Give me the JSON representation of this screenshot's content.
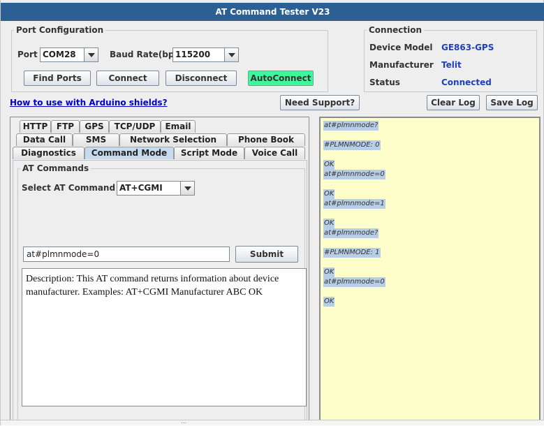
{
  "window": {
    "title": "AT Command Tester V23"
  },
  "port_config": {
    "legend": "Port Configuration",
    "port_label": "Port",
    "port_value": "COM28",
    "baud_label": "Baud Rate(bps)",
    "baud_value": "115200",
    "buttons": {
      "find_ports": "Find Ports",
      "connect": "Connect",
      "disconnect": "Disconnect",
      "autoconnect": "AutoConnect"
    }
  },
  "connection": {
    "legend": "Connection",
    "device_model_label": "Device Model",
    "device_model_value": "GE863-GPS",
    "manufacturer_label": "Manufacturer",
    "manufacturer_value": "Telit",
    "status_label": "Status",
    "status_value": "Connected"
  },
  "toolbar": {
    "arduino_link": "How to use with Arduino shields?",
    "need_support": "Need Support?",
    "clear_log": "Clear Log",
    "save_log": "Save Log"
  },
  "tabs": {
    "row1": [
      "HTTP",
      "FTP",
      "GPS",
      "TCP/UDP",
      "Email"
    ],
    "row2": [
      "Data Call",
      "SMS",
      "Network Selection",
      "Phone Book"
    ],
    "row3": [
      "Diagnostics",
      "Command Mode",
      "Script Mode",
      "Voice Call"
    ],
    "active": "Command Mode"
  },
  "at_commands": {
    "legend": "AT Commands",
    "select_label": "Select AT Command",
    "select_value": "AT+CGMI",
    "input_value": "at#plmnmode=0",
    "submit": "Submit",
    "description": "Description: This AT command returns information about device manufacturer. Examples: AT+CGMI Manufacturer ABC OK"
  },
  "log_lines": [
    "at#plmnmode?",
    "#PLMNMODE: 0",
    "OK",
    "at#plmnmode=0",
    "OK",
    "at#plmnmode=1",
    "OK",
    "at#plmnmode?",
    "#PLMNMODE: 1",
    "OK",
    "at#plmnmode=0",
    "OK"
  ],
  "colors": {
    "titlebar": "#2c5f93",
    "autoconnect": "#3ff69a",
    "log_background": "#ffffcc",
    "link": "#0000cc",
    "value_blue": "#1f3fbf"
  }
}
